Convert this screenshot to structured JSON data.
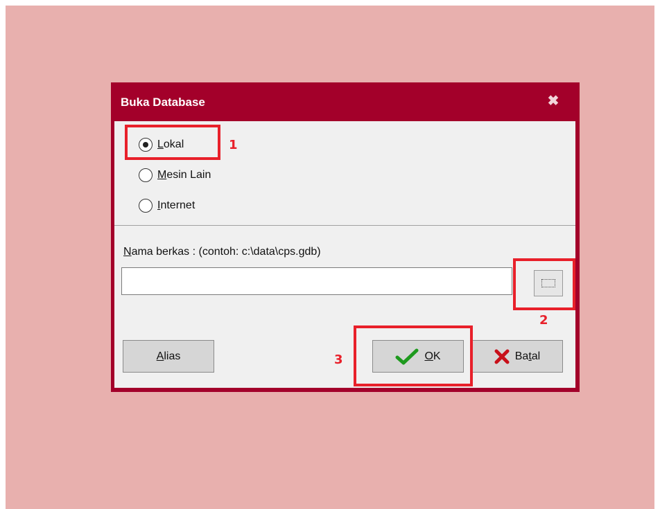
{
  "dialog": {
    "title": "Buka Database",
    "close_icon": "close-icon",
    "radios": [
      {
        "accel": "L",
        "rest": "okal",
        "checked": true
      },
      {
        "accel": "M",
        "rest": "esin Lain",
        "checked": false
      },
      {
        "accel": "I",
        "rest": "nternet",
        "checked": false
      }
    ],
    "file_label_accel": "N",
    "file_label_rest": "ama berkas :  (contoh: c:\\data\\cps.gdb)",
    "file_value": "",
    "buttons": {
      "alias_accel": "A",
      "alias_rest": "lias",
      "ok_accel": "O",
      "ok_rest": "K",
      "batal_pre": "Ba",
      "batal_accel": "t",
      "batal_post": "al"
    }
  },
  "annotations": {
    "n1": "1",
    "n2": "2",
    "n3": "3"
  },
  "colors": {
    "titlebar": "#a3002a",
    "background": "#e8b0ae",
    "highlight": "#e8202a"
  }
}
